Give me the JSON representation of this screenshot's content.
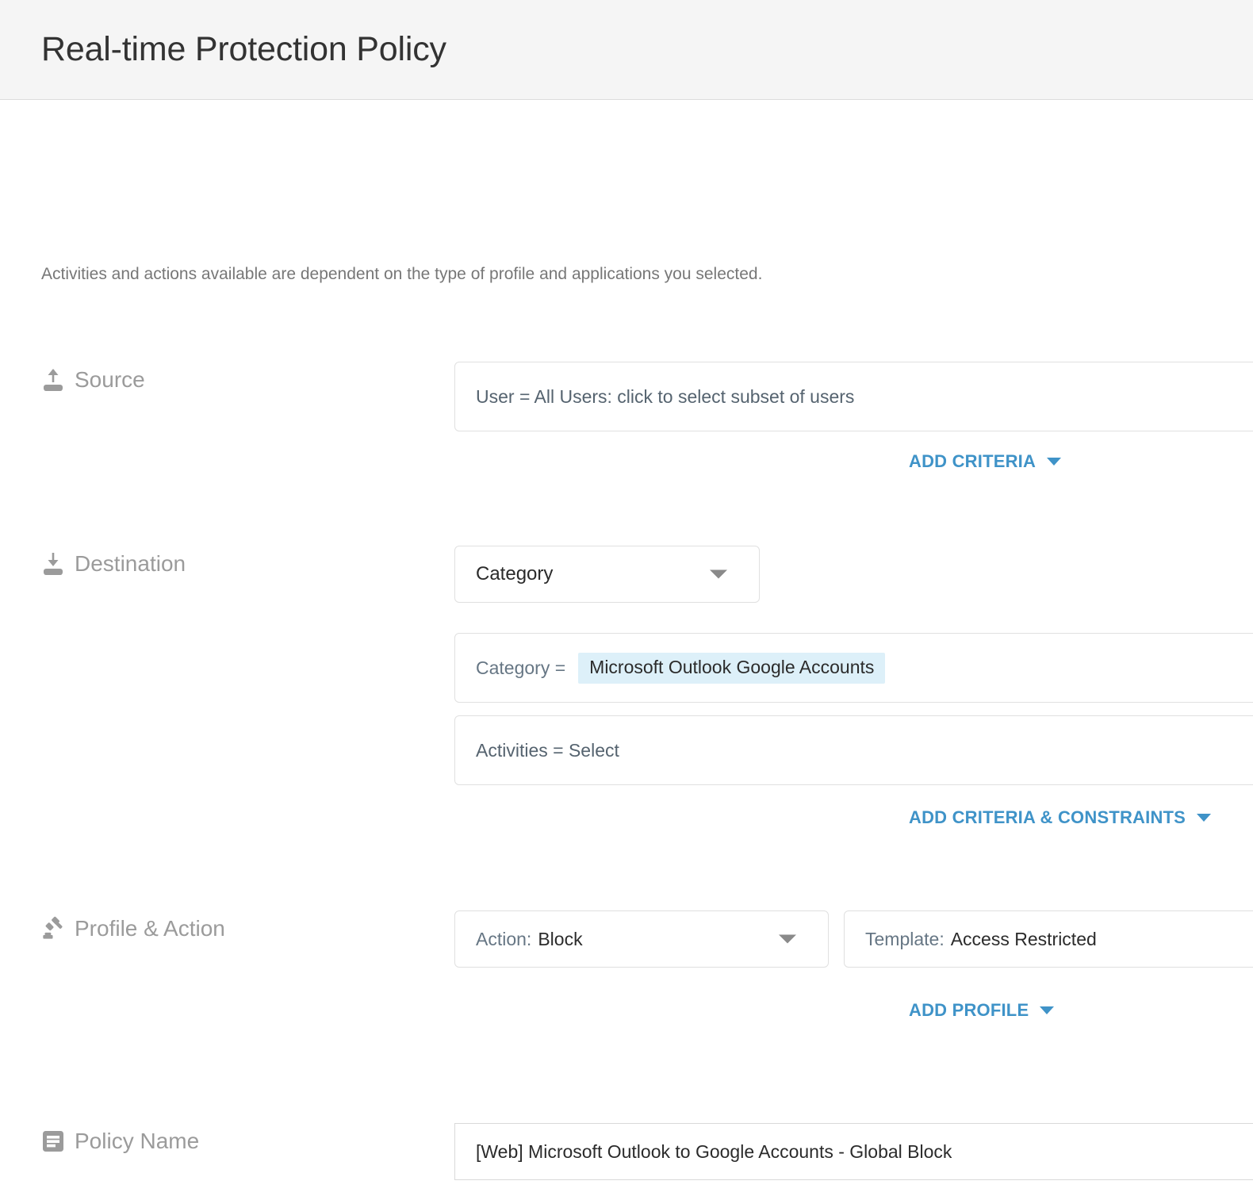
{
  "header": {
    "title": "Real-time Protection Policy"
  },
  "intro": {
    "text": "Activities and actions available are dependent on the type of profile and applications you selected."
  },
  "sections": {
    "source": {
      "label": "Source",
      "icon": "upload-icon",
      "criteria_value": "User = All Users: click to select subset of users",
      "add_link": "ADD CRITERIA"
    },
    "destination": {
      "label": "Destination",
      "icon": "download-icon",
      "type_select": "Category",
      "criteria_label": "Category =",
      "criteria_chip": "Microsoft Outlook Google Accounts",
      "activities_value": "Activities = Select",
      "add_link": "ADD CRITERIA & CONSTRAINTS"
    },
    "profile_action": {
      "label": "Profile & Action",
      "icon": "gavel-icon",
      "action_label": "Action:",
      "action_value": "Block",
      "template_label": "Template:",
      "template_value": "Access Restricted",
      "add_link": "ADD PROFILE"
    },
    "policy_name": {
      "label": "Policy Name",
      "icon": "document-lines-icon",
      "value": "[Web] Microsoft Outlook to Google Accounts - Global Block"
    }
  },
  "colors": {
    "link_blue": "#3f93c8",
    "chip_bg": "#ddf0f9",
    "label_grey": "#9b9b9b",
    "header_bg": "#f5f5f5",
    "field_border": "#e0e0e0"
  }
}
